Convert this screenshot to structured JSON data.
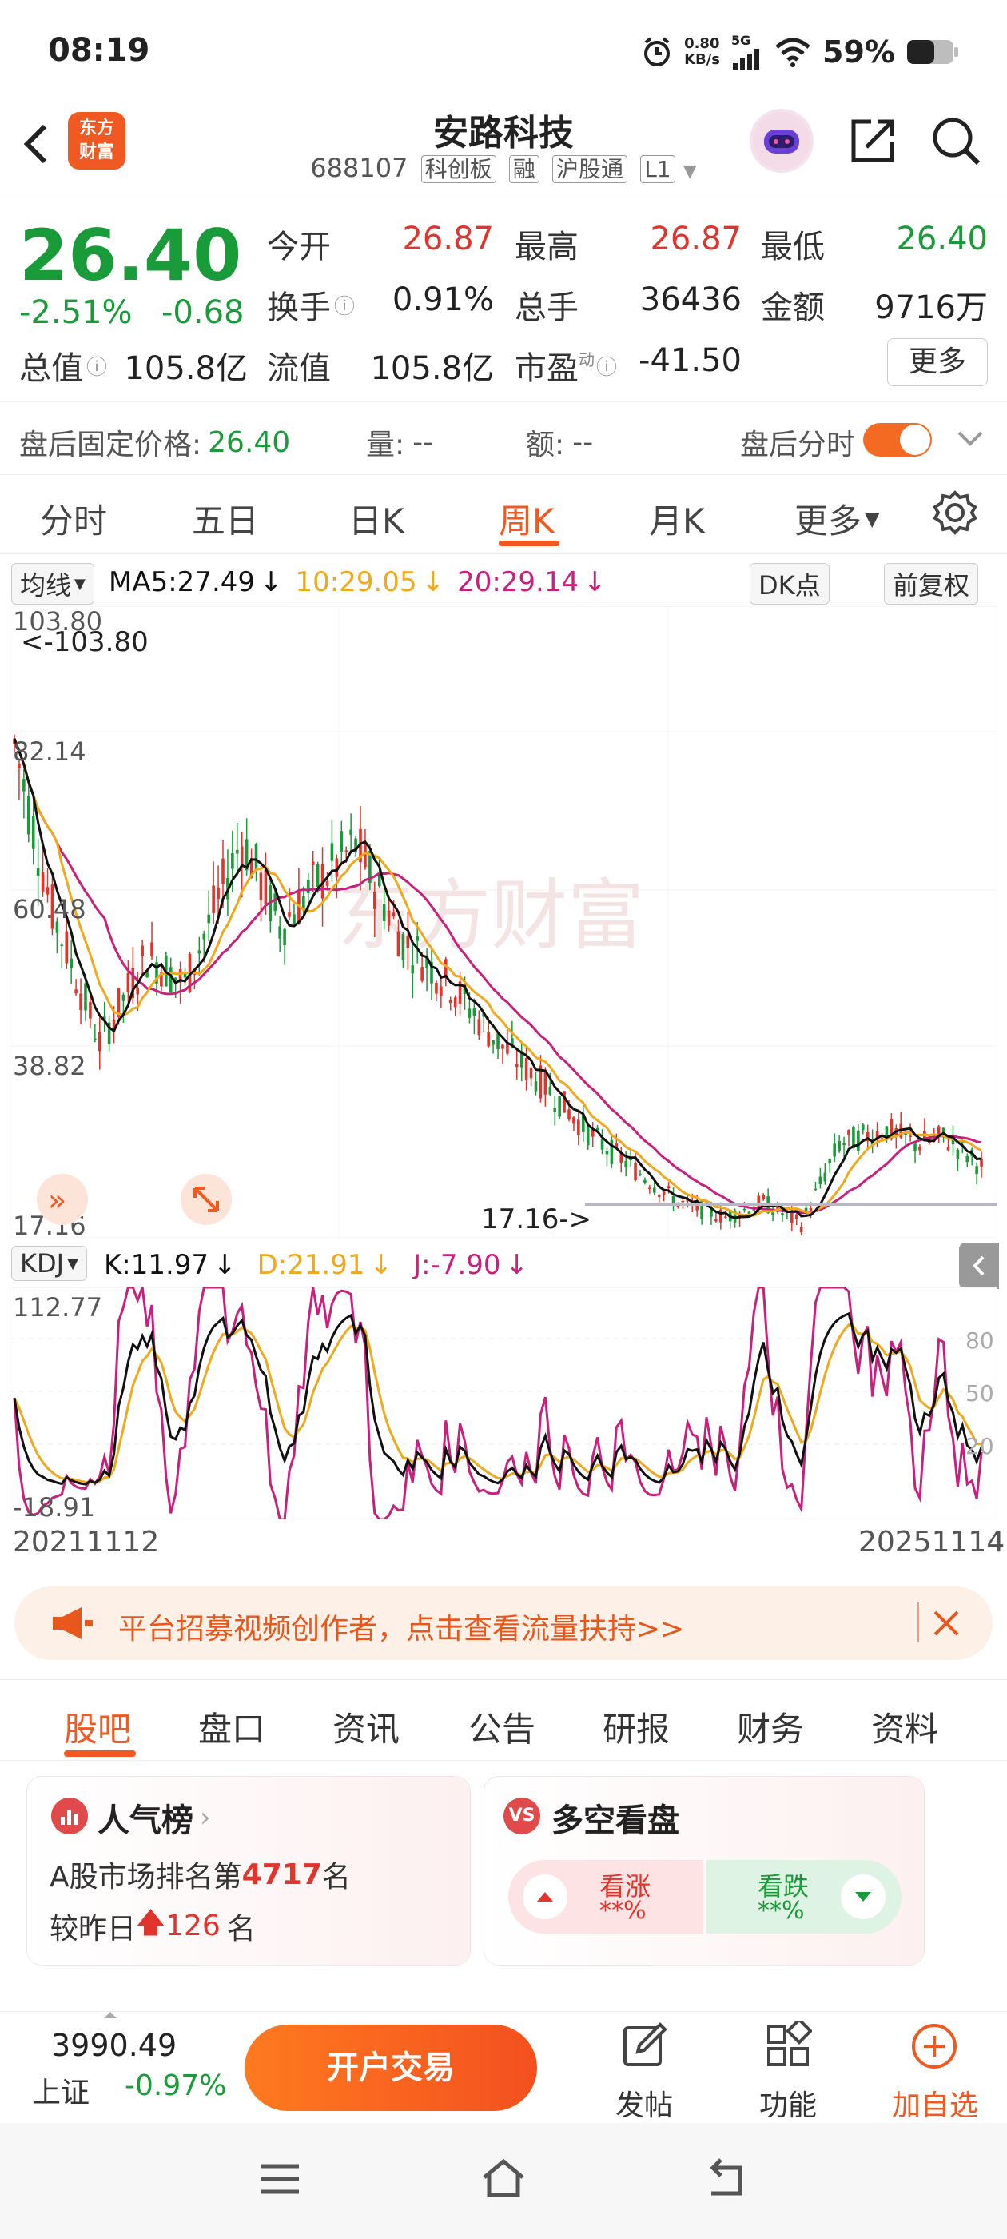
{
  "status": {
    "time": "08:19",
    "net_speed_top": "0.80",
    "net_speed_unit": "KB/s",
    "net_type": "5G",
    "battery": "59%"
  },
  "header": {
    "logo_line1": "东方",
    "logo_line2": "财富",
    "title": "安路科技",
    "code": "688107",
    "tags": [
      "科创板",
      "融",
      "沪股通",
      "L1"
    ]
  },
  "quote": {
    "price": "26.40",
    "change_pct": "-2.51%",
    "change_abs": "-0.68",
    "fields": [
      {
        "label": "今开",
        "value": "26.87"
      },
      {
        "label": "最高",
        "value": "26.87"
      },
      {
        "label": "最低",
        "value": "26.40"
      },
      {
        "label": "换手",
        "value": "0.91%"
      },
      {
        "label": "总手",
        "value": "36436"
      },
      {
        "label": "金额",
        "value": "9716万"
      },
      {
        "label": "总值",
        "value": "105.8亿"
      },
      {
        "label": "流值",
        "value": "105.8亿"
      },
      {
        "label": "市盈",
        "value": "-41.50"
      }
    ],
    "pe_superscript": "动",
    "more_label": "更多"
  },
  "after_hours": {
    "price_label": "盘后固定价格:",
    "price_value": "26.40",
    "volume_label": "量:",
    "volume_value": "--",
    "amount_label": "额:",
    "amount_value": "--",
    "timeshare_label": "盘后分时",
    "toggle_on": true
  },
  "period_tabs": [
    "分时",
    "五日",
    "日K",
    "周K",
    "月K",
    "更多"
  ],
  "active_period": "周K",
  "ma_bar": {
    "selector": "均线",
    "ma5": "MA5:27.49",
    "ma10": "10:29.05",
    "ma20": "20:29.14",
    "arrow": "↓",
    "dk_label": "DK点",
    "adjust_label": "前复权"
  },
  "kchart": {
    "y_labels": [
      "103.80",
      "82.14",
      "60.48",
      "38.82",
      "17.16"
    ],
    "max_marker": "<-103.80",
    "min_marker": "17.16->",
    "watermark": "东方财富"
  },
  "kdj_bar": {
    "selector": "KDJ",
    "k": "K:11.97",
    "d": "D:21.91",
    "j": "J:-7.90",
    "arrow": "↓"
  },
  "kdj_chart": {
    "y_top": "112.77",
    "y_bottom": "-18.91",
    "levels": [
      "80",
      "50",
      "20"
    ]
  },
  "dates": {
    "start": "20211112",
    "end": "20251114"
  },
  "colors": {
    "accent": "#f05a22",
    "down_green": "#1a9b3a",
    "up_red": "#e0342c",
    "ma5": "#111111",
    "ma10": "#f0a81c",
    "ma20": "#c8207c"
  },
  "banner": {
    "text": "平台招募视频创作者，点击查看流量扶持>>"
  },
  "bottom_tabs": [
    "股吧",
    "盘口",
    "资讯",
    "公告",
    "研报",
    "财务",
    "资料"
  ],
  "active_bottom_tab": "股吧",
  "popularity": {
    "title": "人气榜",
    "rank_prefix": "A股市场排名第",
    "rank": "4717",
    "rank_suffix": "名",
    "delta_prefix": "较昨日",
    "delta": "126",
    "delta_suffix": "名"
  },
  "sentiment": {
    "title": "多空看盘",
    "bull_label": "看涨",
    "bull_value": "**%",
    "bear_label": "看跌",
    "bear_value": "**%"
  },
  "bottom_bar": {
    "index_value": "3990.49",
    "index_name": "上证",
    "index_change": "-0.97%",
    "trade_button": "开户交易",
    "post_label": "发帖",
    "function_label": "功能",
    "watchlist_label": "加自选"
  }
}
